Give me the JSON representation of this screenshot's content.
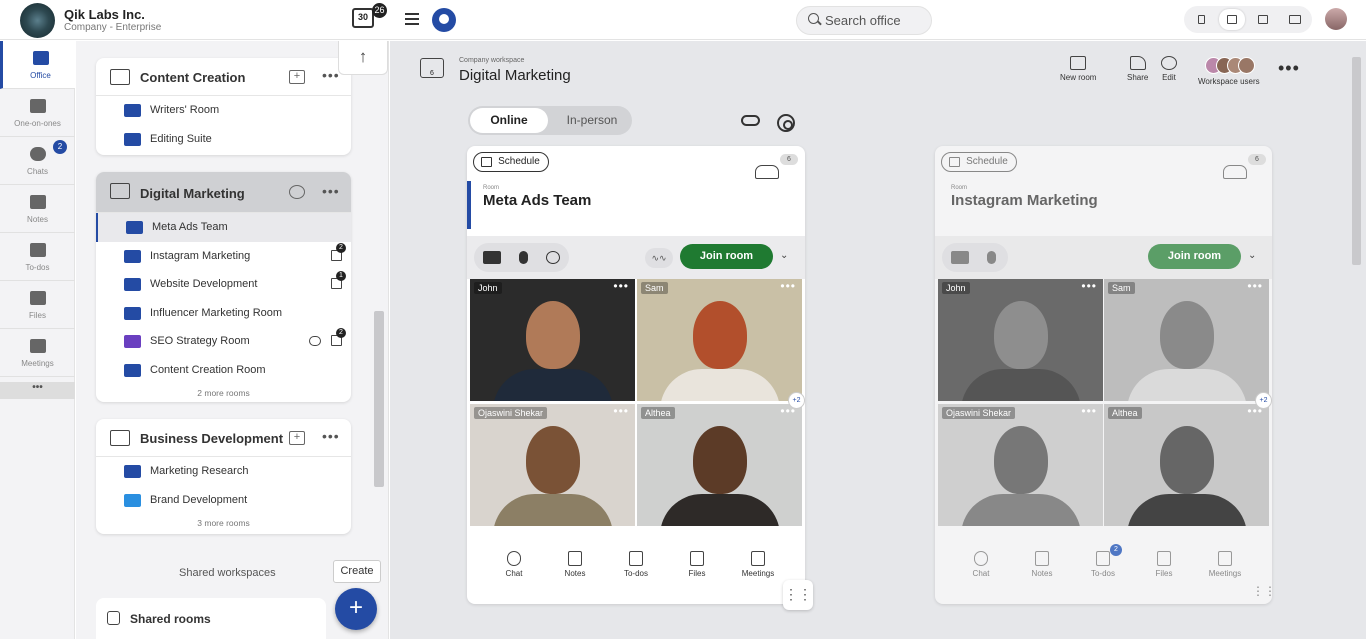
{
  "company": {
    "name": "Qik Labs Inc.",
    "plan": "Company - Enterprise"
  },
  "topbar": {
    "calendar_day": "30",
    "calendar_badge": "26",
    "search_placeholder": "Search office"
  },
  "rail": {
    "items": [
      {
        "label": "Office",
        "icon": "briefcase-icon"
      },
      {
        "label": "One-on-ones",
        "icon": "people-icon"
      },
      {
        "label": "Chats",
        "icon": "chat-icon",
        "badge": "2"
      },
      {
        "label": "Notes",
        "icon": "notes-icon"
      },
      {
        "label": "To-dos",
        "icon": "todo-icon"
      },
      {
        "label": "Files",
        "icon": "file-icon"
      },
      {
        "label": "Meetings",
        "icon": "meetings-icon"
      }
    ],
    "more": "•••"
  },
  "sidebar": {
    "workspaces": [
      {
        "name": "Content Creation",
        "rooms": [
          "Writers' Room",
          "Editing Suite"
        ]
      },
      {
        "name": "Digital Marketing",
        "rooms": [
          "Meta Ads Team",
          "Instagram Marketing",
          "Website Development",
          "Influencer Marketing Room",
          "SEO Strategy Room",
          "Content Creation Room"
        ],
        "more": "2 more rooms",
        "badges": {
          "instagram": "2",
          "website": "1",
          "seo": "2"
        }
      },
      {
        "name": "Business Development",
        "rooms": [
          "Marketing Research",
          "Brand Development"
        ],
        "more": "3 more rooms"
      }
    ],
    "shared_label": "Shared workspaces",
    "create_label": "Create",
    "shared_rooms": "Shared rooms"
  },
  "workspace": {
    "subtitle": "Company workspace",
    "title": "Digital Marketing",
    "icon_count": "6",
    "actions": [
      {
        "label": "New room"
      },
      {
        "label": "Share"
      },
      {
        "label": "Edit"
      },
      {
        "label": "Workspace users"
      }
    ]
  },
  "mode_toggle": {
    "online": "Online",
    "in_person": "In-person"
  },
  "rooms": [
    {
      "schedule": "Schedule",
      "count": "6",
      "label": "Room",
      "name": "Meta Ads Team",
      "join": "Join room",
      "participants": [
        "John",
        "Sam",
        "Ojaswini Shekar",
        "Althea"
      ],
      "extra": "+2",
      "footer": [
        "Chat",
        "Notes",
        "To-dos",
        "Files",
        "Meetings"
      ]
    },
    {
      "schedule": "Schedule",
      "count": "6",
      "label": "Room",
      "name": "Instagram Marketing",
      "join": "Join room",
      "participants": [
        "John",
        "Sam",
        "Ojaswini Shekar",
        "Althea"
      ],
      "extra": "+2",
      "footer": [
        "Chat",
        "Notes",
        "To-dos",
        "Files",
        "Meetings"
      ],
      "todo_badge": "2"
    }
  ],
  "colors": {
    "accent": "#244ba4",
    "join": "#1f7a31",
    "room_purple": "#6a3fc0",
    "room_lightblue": "#2a8fe0"
  }
}
